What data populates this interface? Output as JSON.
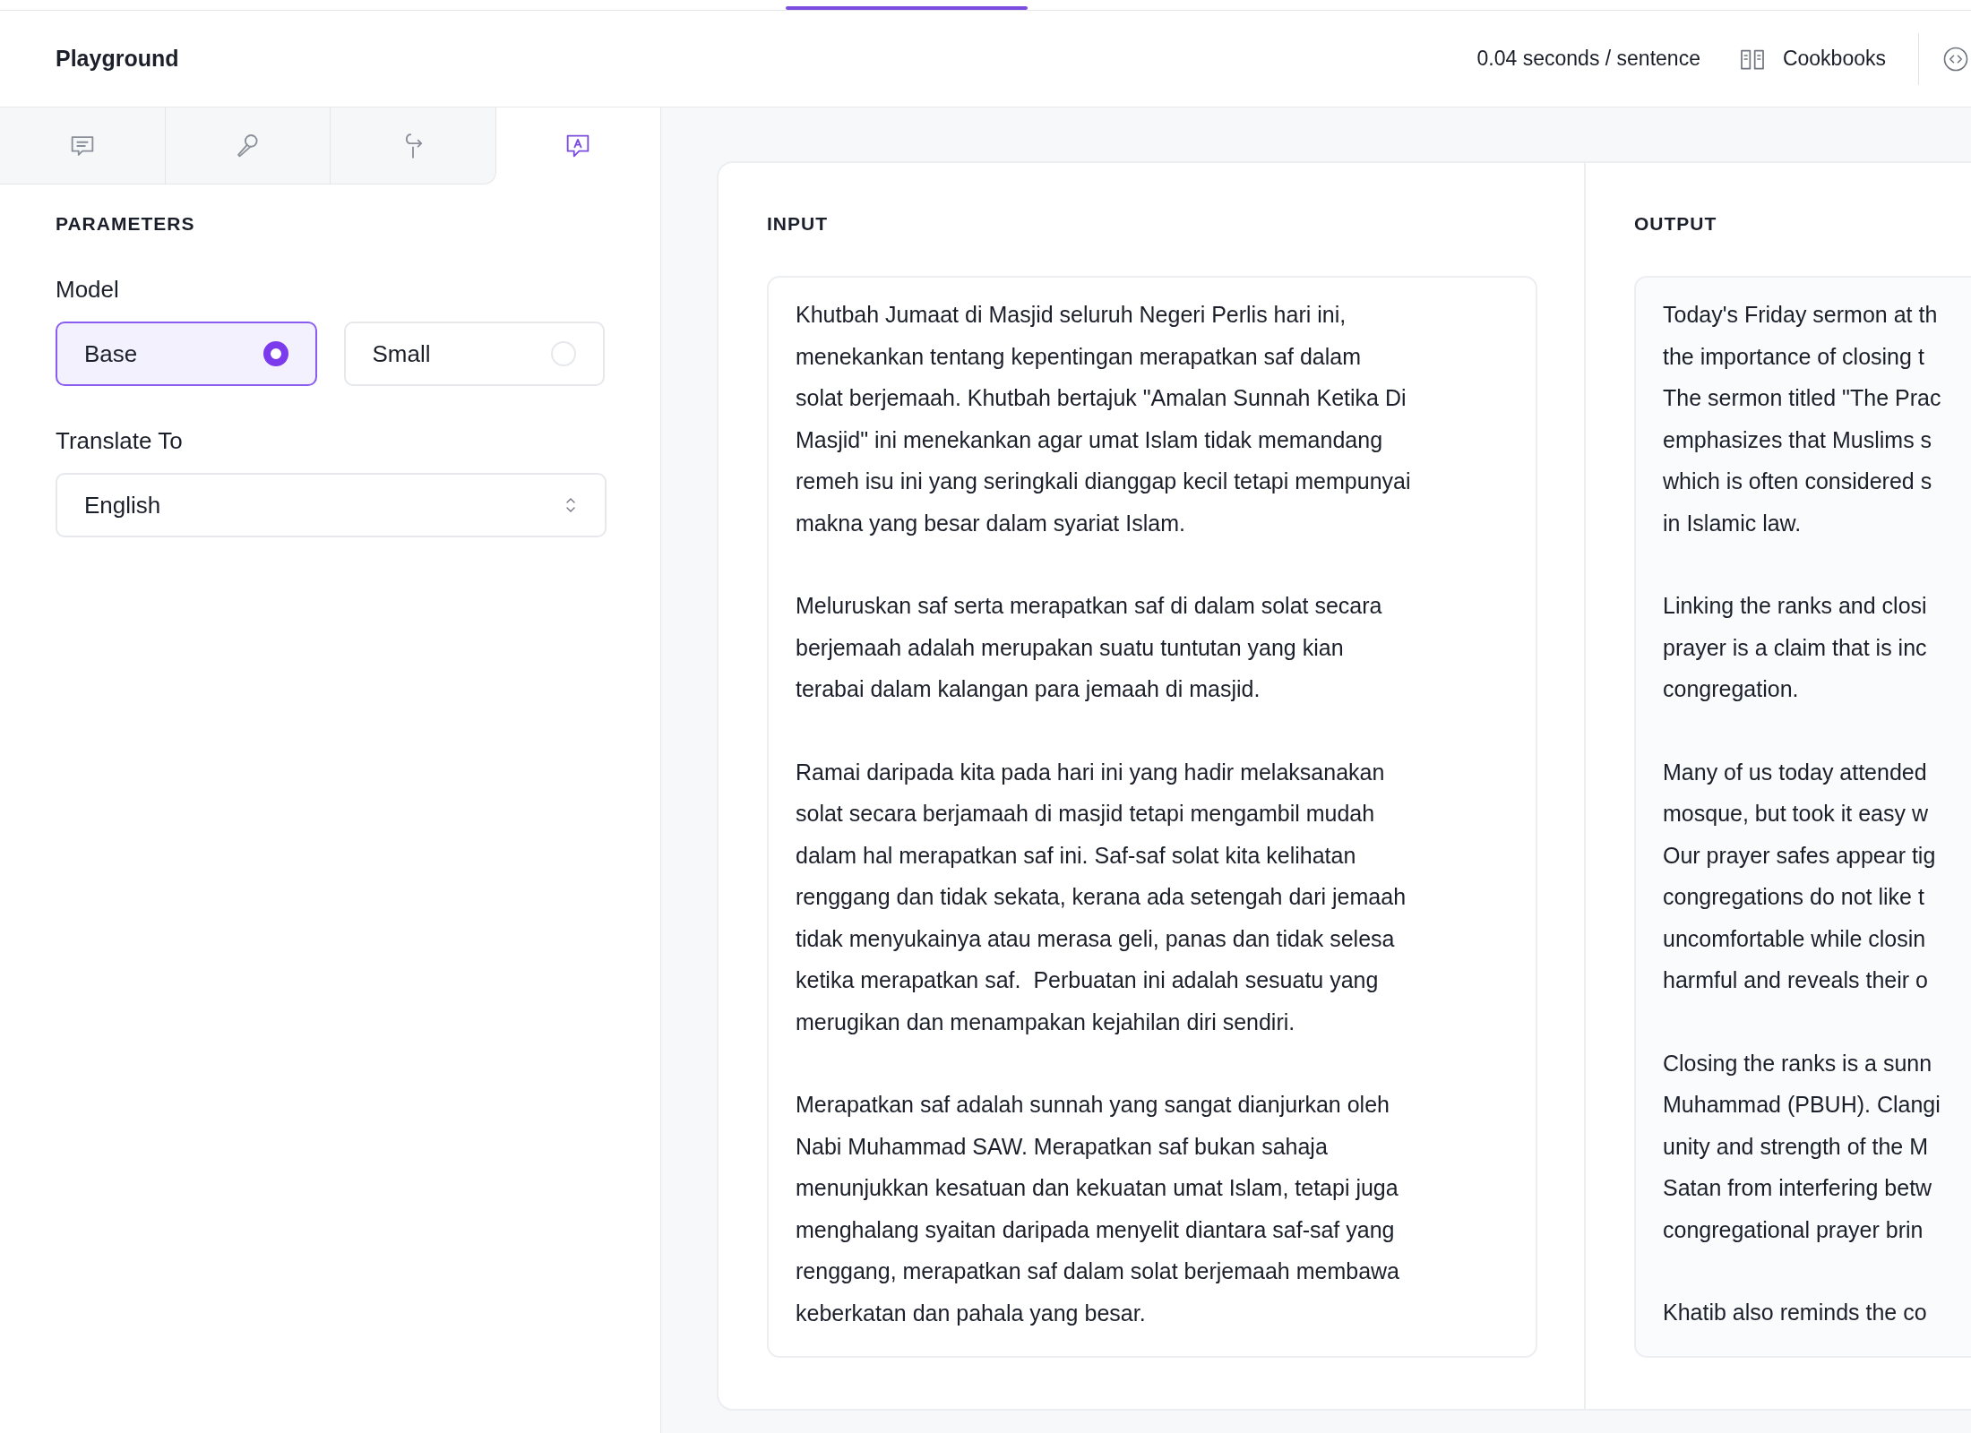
{
  "header": {
    "title": "Playground",
    "speed": "0.04 seconds / sentence",
    "cookbooks": "Cookbooks"
  },
  "mode_tabs": [
    {
      "kind": "chat",
      "selected": false
    },
    {
      "kind": "microphone",
      "selected": false
    },
    {
      "kind": "redirect",
      "selected": false
    },
    {
      "kind": "translate",
      "selected": true
    }
  ],
  "parameters": {
    "heading": "PARAMETERS",
    "model_label": "Model",
    "models": [
      {
        "label": "Base",
        "selected": true
      },
      {
        "label": "Small",
        "selected": false
      }
    ],
    "translate_label": "Translate To",
    "language": "English"
  },
  "input": {
    "heading": "INPUT",
    "paragraphs": [
      [
        "Khutbah Jumaat di Masjid seluruh Negeri Perlis hari ini,",
        "menekankan tentang kepentingan merapatkan saf dalam",
        "solat berjemaah. Khutbah bertajuk \"Amalan Sunnah Ketika Di",
        "Masjid\" ini menekankan agar umat Islam tidak memandang",
        "remeh isu ini yang seringkali dianggap kecil tetapi mempunyai",
        "makna yang besar dalam syariat Islam."
      ],
      [
        "Meluruskan saf serta merapatkan saf di dalam solat secara",
        "berjemaah adalah merupakan suatu tuntutan yang kian",
        "terabai dalam kalangan para jemaah di masjid."
      ],
      [
        "Ramai daripada kita pada hari ini yang hadir melaksanakan",
        "solat secara berjamaah di masjid tetapi mengambil mudah",
        "dalam hal merapatkan saf ini. Saf-saf solat kita kelihatan",
        "renggang dan tidak sekata, kerana ada setengah dari jemaah",
        "tidak menyukainya atau merasa geli, panas dan tidak selesa",
        "ketika merapatkan saf.  Perbuatan ini adalah sesuatu yang",
        "merugikan dan menampakan kejahilan diri sendiri."
      ],
      [
        "Merapatkan saf adalah sunnah yang sangat dianjurkan oleh",
        "Nabi Muhammad SAW. Merapatkan saf bukan sahaja",
        "menunjukkan kesatuan dan kekuatan umat Islam, tetapi juga",
        "menghalang syaitan daripada menyelit diantara saf-saf yang",
        "renggang, merapatkan saf dalam solat berjemaah membawa",
        "keberkatan dan pahala yang besar."
      ]
    ]
  },
  "output": {
    "heading": "OUTPUT",
    "paragraphs": [
      [
        "Today's Friday sermon at th",
        "the importance of closing t",
        "The sermon titled \"The Prac",
        "emphasizes that Muslims s",
        "which is often considered s",
        "in Islamic law."
      ],
      [
        "Linking the ranks and closi",
        "prayer is a claim that is inc",
        "congregation."
      ],
      [
        "Many of us today attended",
        "mosque, but took it easy w",
        "Our prayer safes appear tig",
        "congregations do not like t",
        "uncomfortable while closin",
        "harmful and reveals their o"
      ],
      [
        "Closing the ranks is a sunn",
        "Muhammad (PBUH). Clangi",
        "unity and strength of the M",
        "Satan from interfering betw",
        "congregational prayer brin"
      ],
      [
        "Khatib also reminds the co"
      ]
    ]
  }
}
